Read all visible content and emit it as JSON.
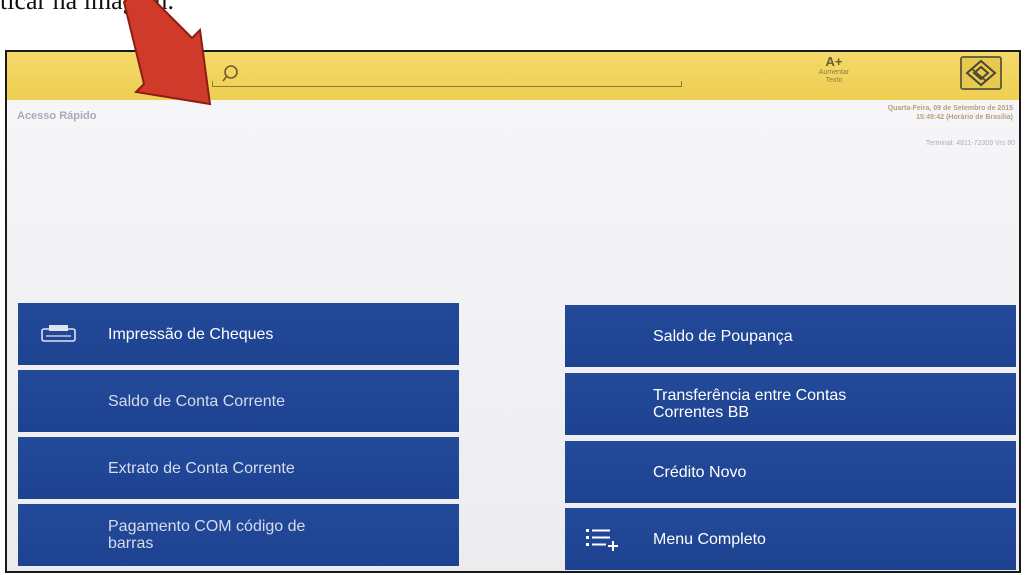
{
  "caption": "ticar na imagem.",
  "header": {
    "search": {
      "placeholder": ""
    },
    "font_button": {
      "label": "A+",
      "sublabel_1": "Aumentar",
      "sublabel_2": "Texto"
    }
  },
  "subheader": {
    "title": "Acesso Rápido",
    "date_line": "Quarta-Feira, 09 de Setembro de 2015",
    "time_line": "15:49:42 (Horário de Brasília)",
    "terminal": "Terminal: 4811-72309 Vrs 80"
  },
  "menu": {
    "left": [
      {
        "label": "Impressão de Cheques",
        "icon": "check-printer-icon"
      },
      {
        "label": "Saldo de Conta Corrente"
      },
      {
        "label": "Extrato de Conta Corrente"
      },
      {
        "label_1": "Pagamento COM código de",
        "label_2": "barras"
      }
    ],
    "right": [
      {
        "label": "Saldo de Poupança"
      },
      {
        "label_1": "Transferência entre Contas",
        "label_2": "Correntes BB"
      },
      {
        "label": "Crédito Novo"
      },
      {
        "label": "Menu Completo",
        "icon": "list-add-icon"
      }
    ]
  },
  "colors": {
    "header_yellow": "#f0d05a",
    "tile_blue": "#234a9a",
    "arrow_red": "#d2382a"
  },
  "icons": [
    "search-icon",
    "bb-logo-icon",
    "annotation-arrow-icon"
  ]
}
